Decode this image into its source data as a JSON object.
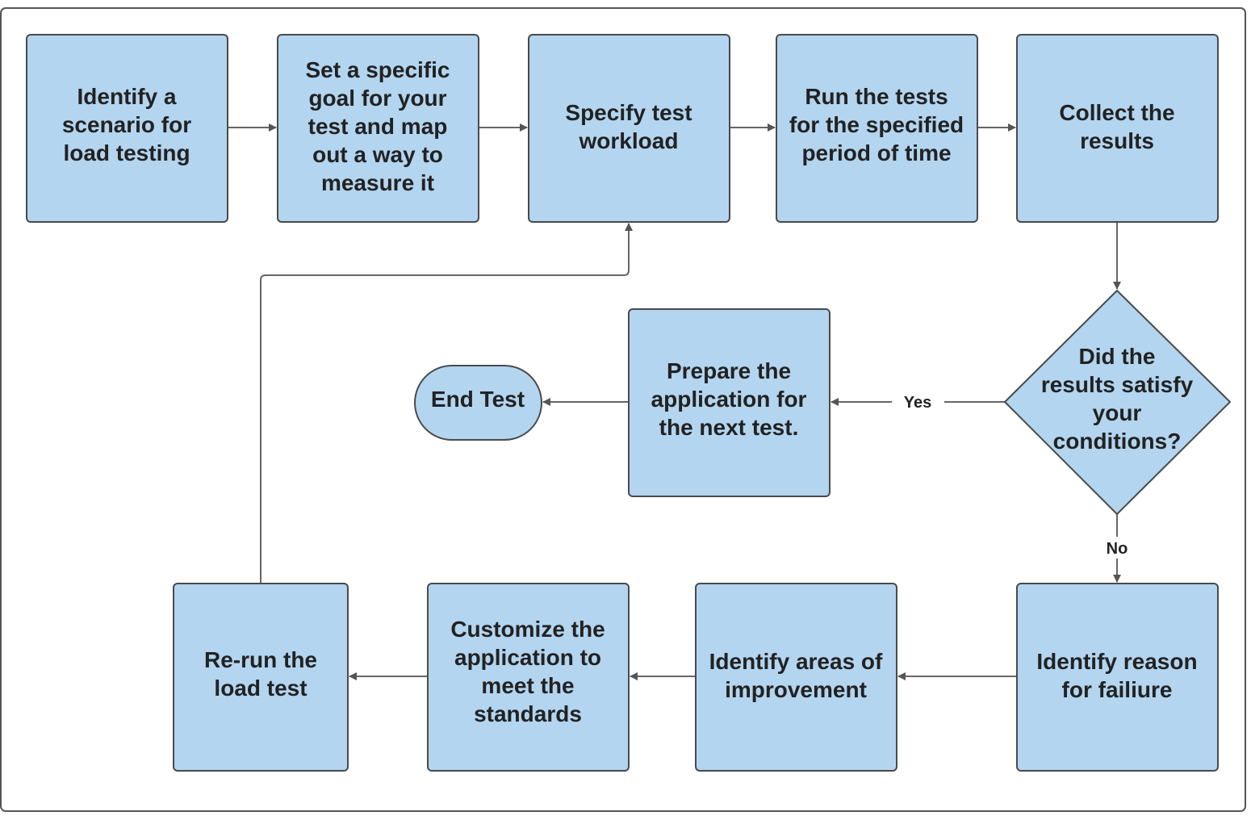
{
  "nodes": {
    "identify_scenario": [
      "Identify a",
      "scenario for",
      "load testing"
    ],
    "set_goal": [
      "Set a specific",
      "goal for your",
      "test and map",
      "out a way to",
      "measure it"
    ],
    "specify_workload": [
      "Specify test",
      "workload"
    ],
    "run_tests": [
      "Run the tests",
      "for the specified",
      "period of time"
    ],
    "collect_results": [
      "Collect the",
      "results"
    ],
    "decision": [
      "Did the",
      "results satisfy",
      "your",
      "conditions?"
    ],
    "prepare_next": [
      "Prepare the",
      "application for",
      "the next test."
    ],
    "end_test": [
      "End Test"
    ],
    "identify_reason": [
      "Identify reason",
      "for failiure"
    ],
    "identify_areas": [
      "Identify areas of",
      "improvement"
    ],
    "customize": [
      "Customize the",
      "application to",
      "meet the",
      "standards"
    ],
    "rerun": [
      "Re-run the",
      "load test"
    ]
  },
  "edge_labels": {
    "yes": "Yes",
    "no": "No"
  },
  "colors": {
    "node_fill": "#b3d5f0",
    "node_stroke": "#4a4a4a",
    "edge": "#666666"
  }
}
